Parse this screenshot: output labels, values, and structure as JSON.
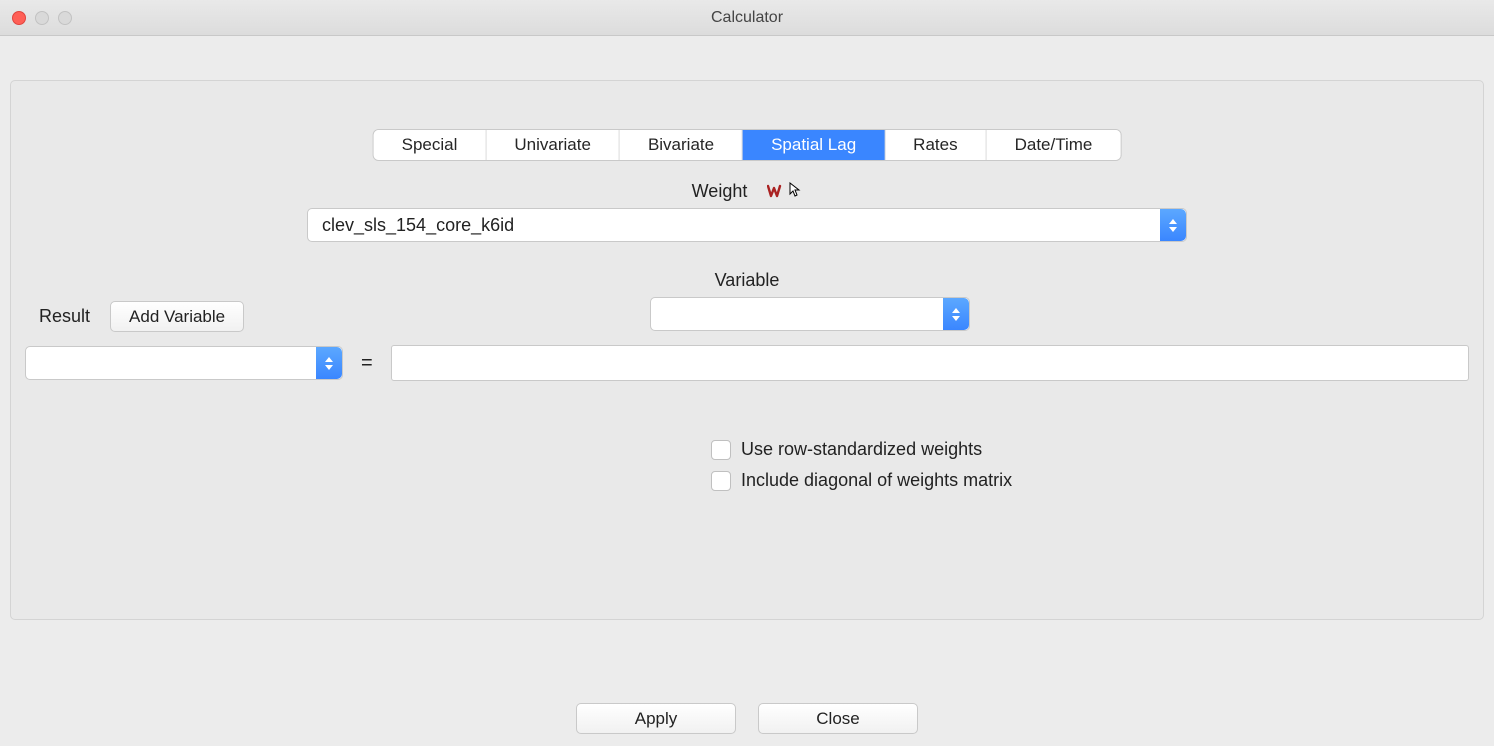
{
  "window": {
    "title": "Calculator"
  },
  "tabs": {
    "t0": "Special",
    "t1": "Univariate",
    "t2": "Bivariate",
    "t3": "Spatial Lag",
    "t4": "Rates",
    "t5": "Date/Time"
  },
  "labels": {
    "weight": "Weight",
    "variable": "Variable",
    "result": "Result",
    "equals": "="
  },
  "selects": {
    "weight_value": "clev_sls_154_core_k6id",
    "variable_value": "",
    "result_value": ""
  },
  "buttons": {
    "add_variable": "Add Variable",
    "apply": "Apply",
    "close": "Close"
  },
  "checkboxes": {
    "row_std": "Use row-standardized weights",
    "diag": "Include diagonal of weights matrix"
  },
  "formula": {
    "value": ""
  }
}
